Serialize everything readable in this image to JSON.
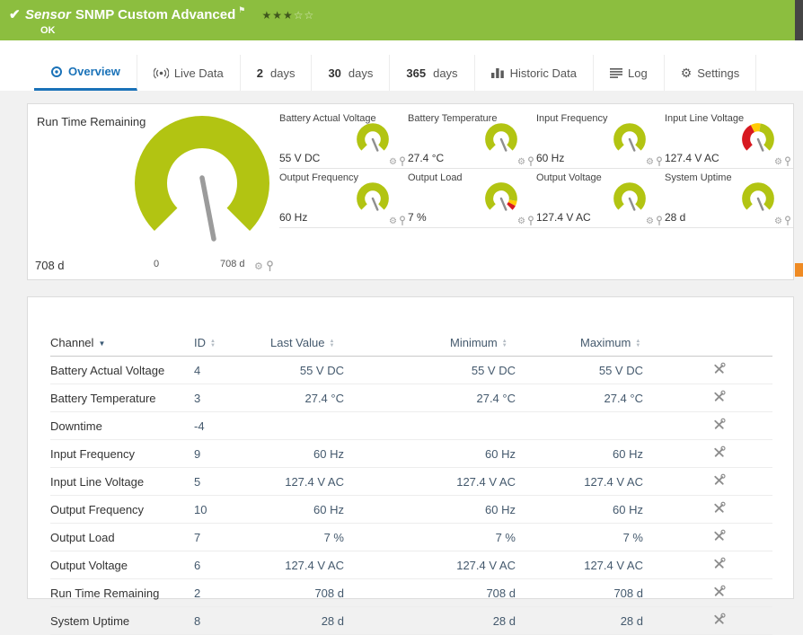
{
  "glyphs": {
    "check": "✔",
    "flag": "⚑",
    "gear": "⚙",
    "stars_filled": "★★★",
    "stars_empty": "☆☆",
    "sort_desc": "▼",
    "sort_up": "▲",
    "sort_down": "▼"
  },
  "header": {
    "kind_label": "Sensor",
    "title": "SNMP Custom Advanced",
    "status": "OK"
  },
  "tabs": {
    "items": [
      {
        "label": "Overview",
        "icon": "overview-icon",
        "active": true
      },
      {
        "label": "Live Data",
        "icon": "live-data-icon"
      },
      {
        "prefix": "2",
        "label": "days"
      },
      {
        "prefix": "30",
        "label": "days"
      },
      {
        "prefix": "365",
        "label": "days"
      },
      {
        "label": "Historic Data",
        "icon": "historic-data-icon"
      },
      {
        "label": "Log",
        "icon": "log-icon"
      },
      {
        "label": "Settings",
        "icon": "settings-icon"
      }
    ]
  },
  "gauges": {
    "main": {
      "title": "Run Time Remaining",
      "value": "708 d",
      "scale_start": "0",
      "scale_end": "708 d"
    },
    "small": [
      {
        "title": "Battery Actual Voltage",
        "value": "55 V DC",
        "style": "green"
      },
      {
        "title": "Battery Temperature",
        "value": "27.4 °C",
        "style": "green"
      },
      {
        "title": "Input Frequency",
        "value": "60 Hz",
        "style": "green"
      },
      {
        "title": "Input Line Voltage",
        "value": "127.4 V AC",
        "style": "red-yellow-green"
      },
      {
        "title": "Output Frequency",
        "value": "60 Hz",
        "style": "green"
      },
      {
        "title": "Output Load",
        "value": "7 %",
        "style": "green-yellow-red"
      },
      {
        "title": "Output Voltage",
        "value": "127.4 V AC",
        "style": "green"
      },
      {
        "title": "System Uptime",
        "value": "28 d",
        "style": "green"
      }
    ]
  },
  "table": {
    "columns": [
      {
        "label": "Channel",
        "sort": "desc"
      },
      {
        "label": "ID",
        "sort": "both"
      },
      {
        "label": "Last Value",
        "sort": "both"
      },
      {
        "label": "Minimum",
        "sort": "both"
      },
      {
        "label": "Maximum",
        "sort": "both"
      }
    ],
    "rows": [
      {
        "channel": "Battery Actual Voltage",
        "id": "4",
        "last_value": "55 V DC",
        "minimum": "55 V DC",
        "maximum": "55 V DC"
      },
      {
        "channel": "Battery Temperature",
        "id": "3",
        "last_value": "27.4 °C",
        "minimum": "27.4 °C",
        "maximum": "27.4 °C"
      },
      {
        "channel": "Downtime",
        "id": "-4",
        "last_value": "",
        "minimum": "",
        "maximum": ""
      },
      {
        "channel": "Input Frequency",
        "id": "9",
        "last_value": "60 Hz",
        "minimum": "60 Hz",
        "maximum": "60 Hz"
      },
      {
        "channel": "Input Line Voltage",
        "id": "5",
        "last_value": "127.4 V AC",
        "minimum": "127.4 V AC",
        "maximum": "127.4 V AC"
      },
      {
        "channel": "Output Frequency",
        "id": "10",
        "last_value": "60 Hz",
        "minimum": "60 Hz",
        "maximum": "60 Hz"
      },
      {
        "channel": "Output Load",
        "id": "7",
        "last_value": "7 %",
        "minimum": "7 %",
        "maximum": "7 %"
      },
      {
        "channel": "Output Voltage",
        "id": "6",
        "last_value": "127.4 V AC",
        "minimum": "127.4 V AC",
        "maximum": "127.4 V AC"
      },
      {
        "channel": "Run Time Remaining",
        "id": "2",
        "last_value": "708 d",
        "minimum": "708 d",
        "maximum": "708 d"
      },
      {
        "channel": "System Uptime",
        "id": "8",
        "last_value": "28 d",
        "minimum": "28 d",
        "maximum": "28 d"
      }
    ]
  },
  "colors": {
    "header_green": "#8cbe3f",
    "gauge_green": "#b2c412",
    "gauge_red": "#d71920",
    "gauge_yellow": "#ffcb05",
    "accent_blue": "#1a72b8",
    "edge_orange": "#ef8b24"
  }
}
